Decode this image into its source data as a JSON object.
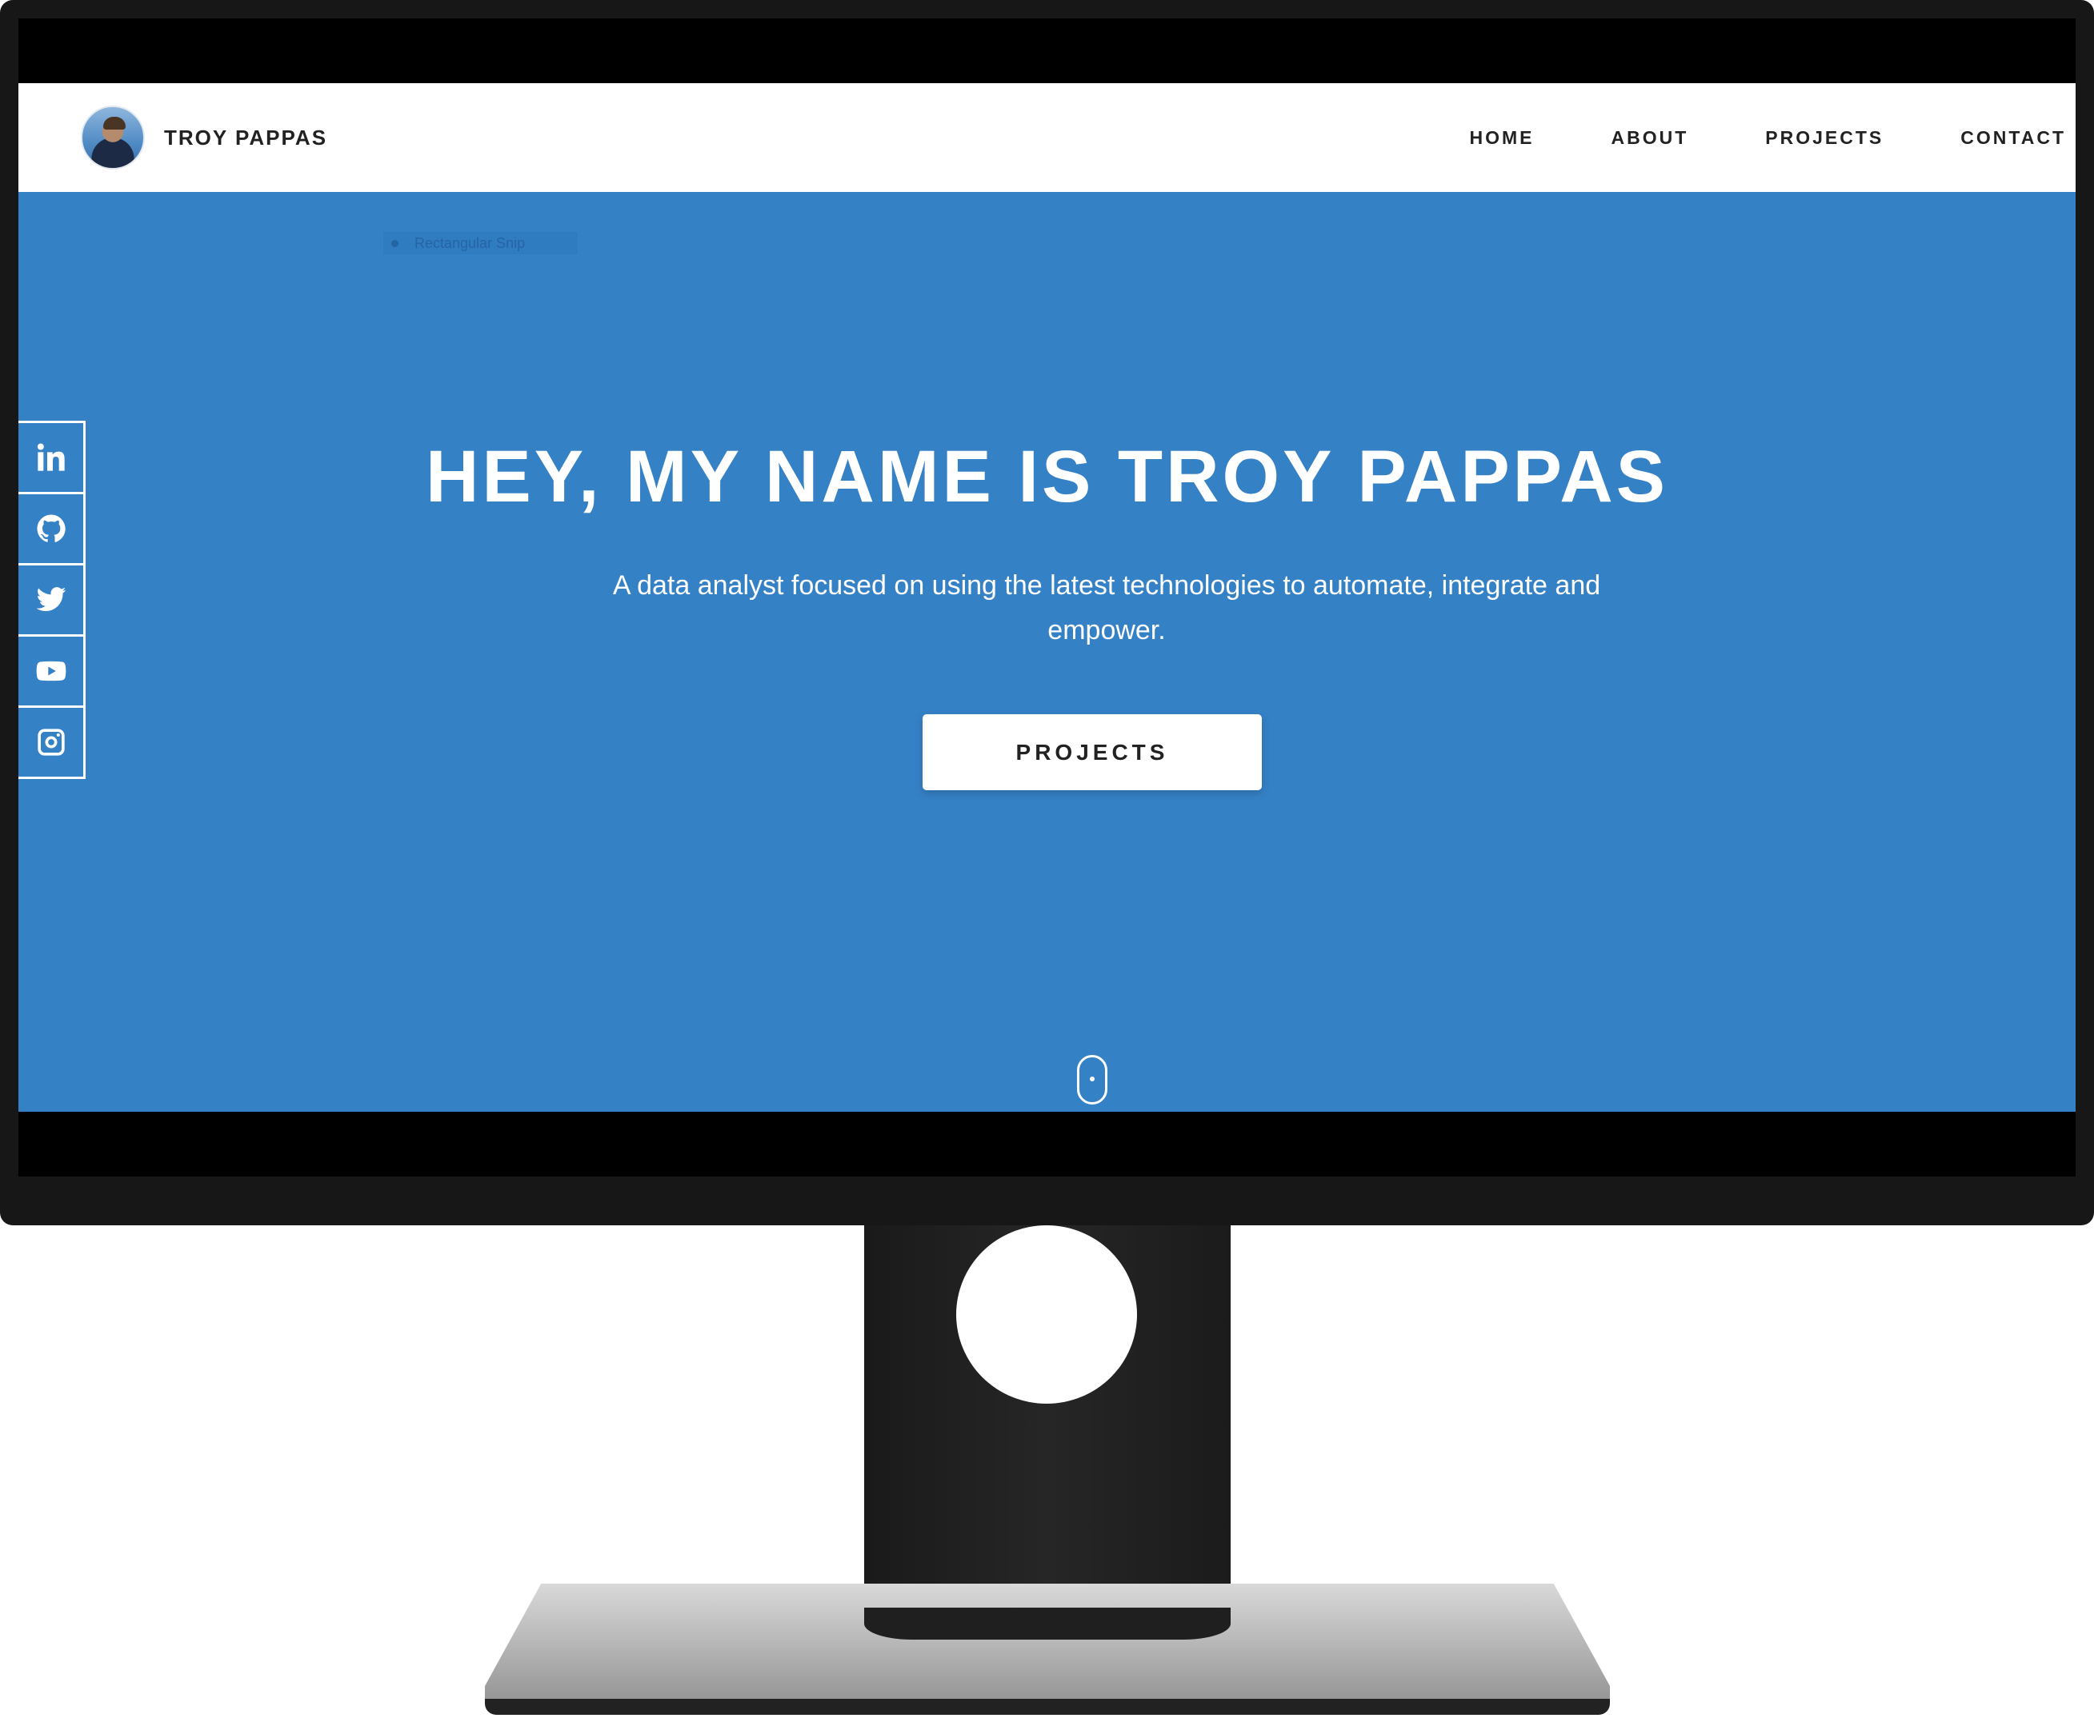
{
  "header": {
    "brand_name": "TROY PAPPAS",
    "nav": [
      "HOME",
      "ABOUT",
      "PROJECTS",
      "CONTACT"
    ]
  },
  "overlay": {
    "snip_label": "Rectangular Snip"
  },
  "social": [
    {
      "icon": "linkedin-icon"
    },
    {
      "icon": "github-icon"
    },
    {
      "icon": "twitter-icon"
    },
    {
      "icon": "youtube-icon"
    },
    {
      "icon": "instagram-icon"
    }
  ],
  "hero": {
    "title": "HEY, MY NAME IS TROY PAPPAS",
    "subtitle": "A data analyst focused on using the latest technologies to automate, integrate and empower.",
    "button_label": "PROJECTS"
  },
  "colors": {
    "hero_background": "#3581c6",
    "navbar_background": "#ffffff",
    "monitor_bezel": "#171717"
  }
}
